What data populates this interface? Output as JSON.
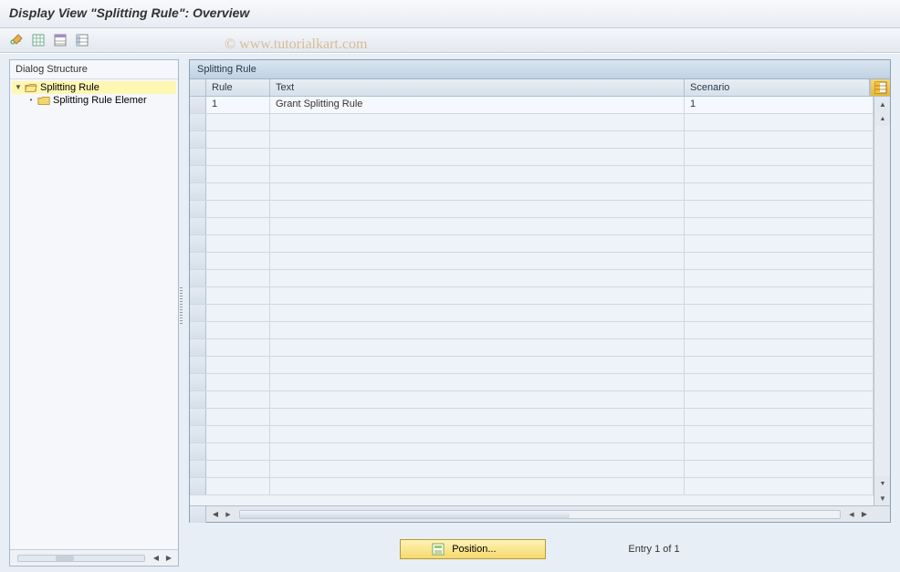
{
  "title": "Display View \"Splitting Rule\": Overview",
  "watermark": "© www.tutorialkart.com",
  "toolbar": {
    "icons": [
      "toggle-display-change",
      "expand-all",
      "collapse-all",
      "select-block"
    ]
  },
  "sidebar": {
    "title": "Dialog Structure",
    "nodes": [
      {
        "label": "Splitting Rule",
        "level": 0,
        "expanded": true,
        "selected": true,
        "open_folder": true
      },
      {
        "label": "Splitting Rule Elemer",
        "level": 1,
        "expanded": false,
        "selected": false,
        "open_folder": false
      }
    ]
  },
  "panel": {
    "title": "Splitting Rule",
    "columns": {
      "rule": "Rule",
      "text": "Text",
      "scenario": "Scenario"
    },
    "rows": [
      {
        "rule": "1",
        "text": "Grant Splitting Rule",
        "scenario": "1"
      }
    ],
    "empty_row_count": 22
  },
  "footer": {
    "position_label": "Position...",
    "entry_text": "Entry 1 of 1"
  }
}
